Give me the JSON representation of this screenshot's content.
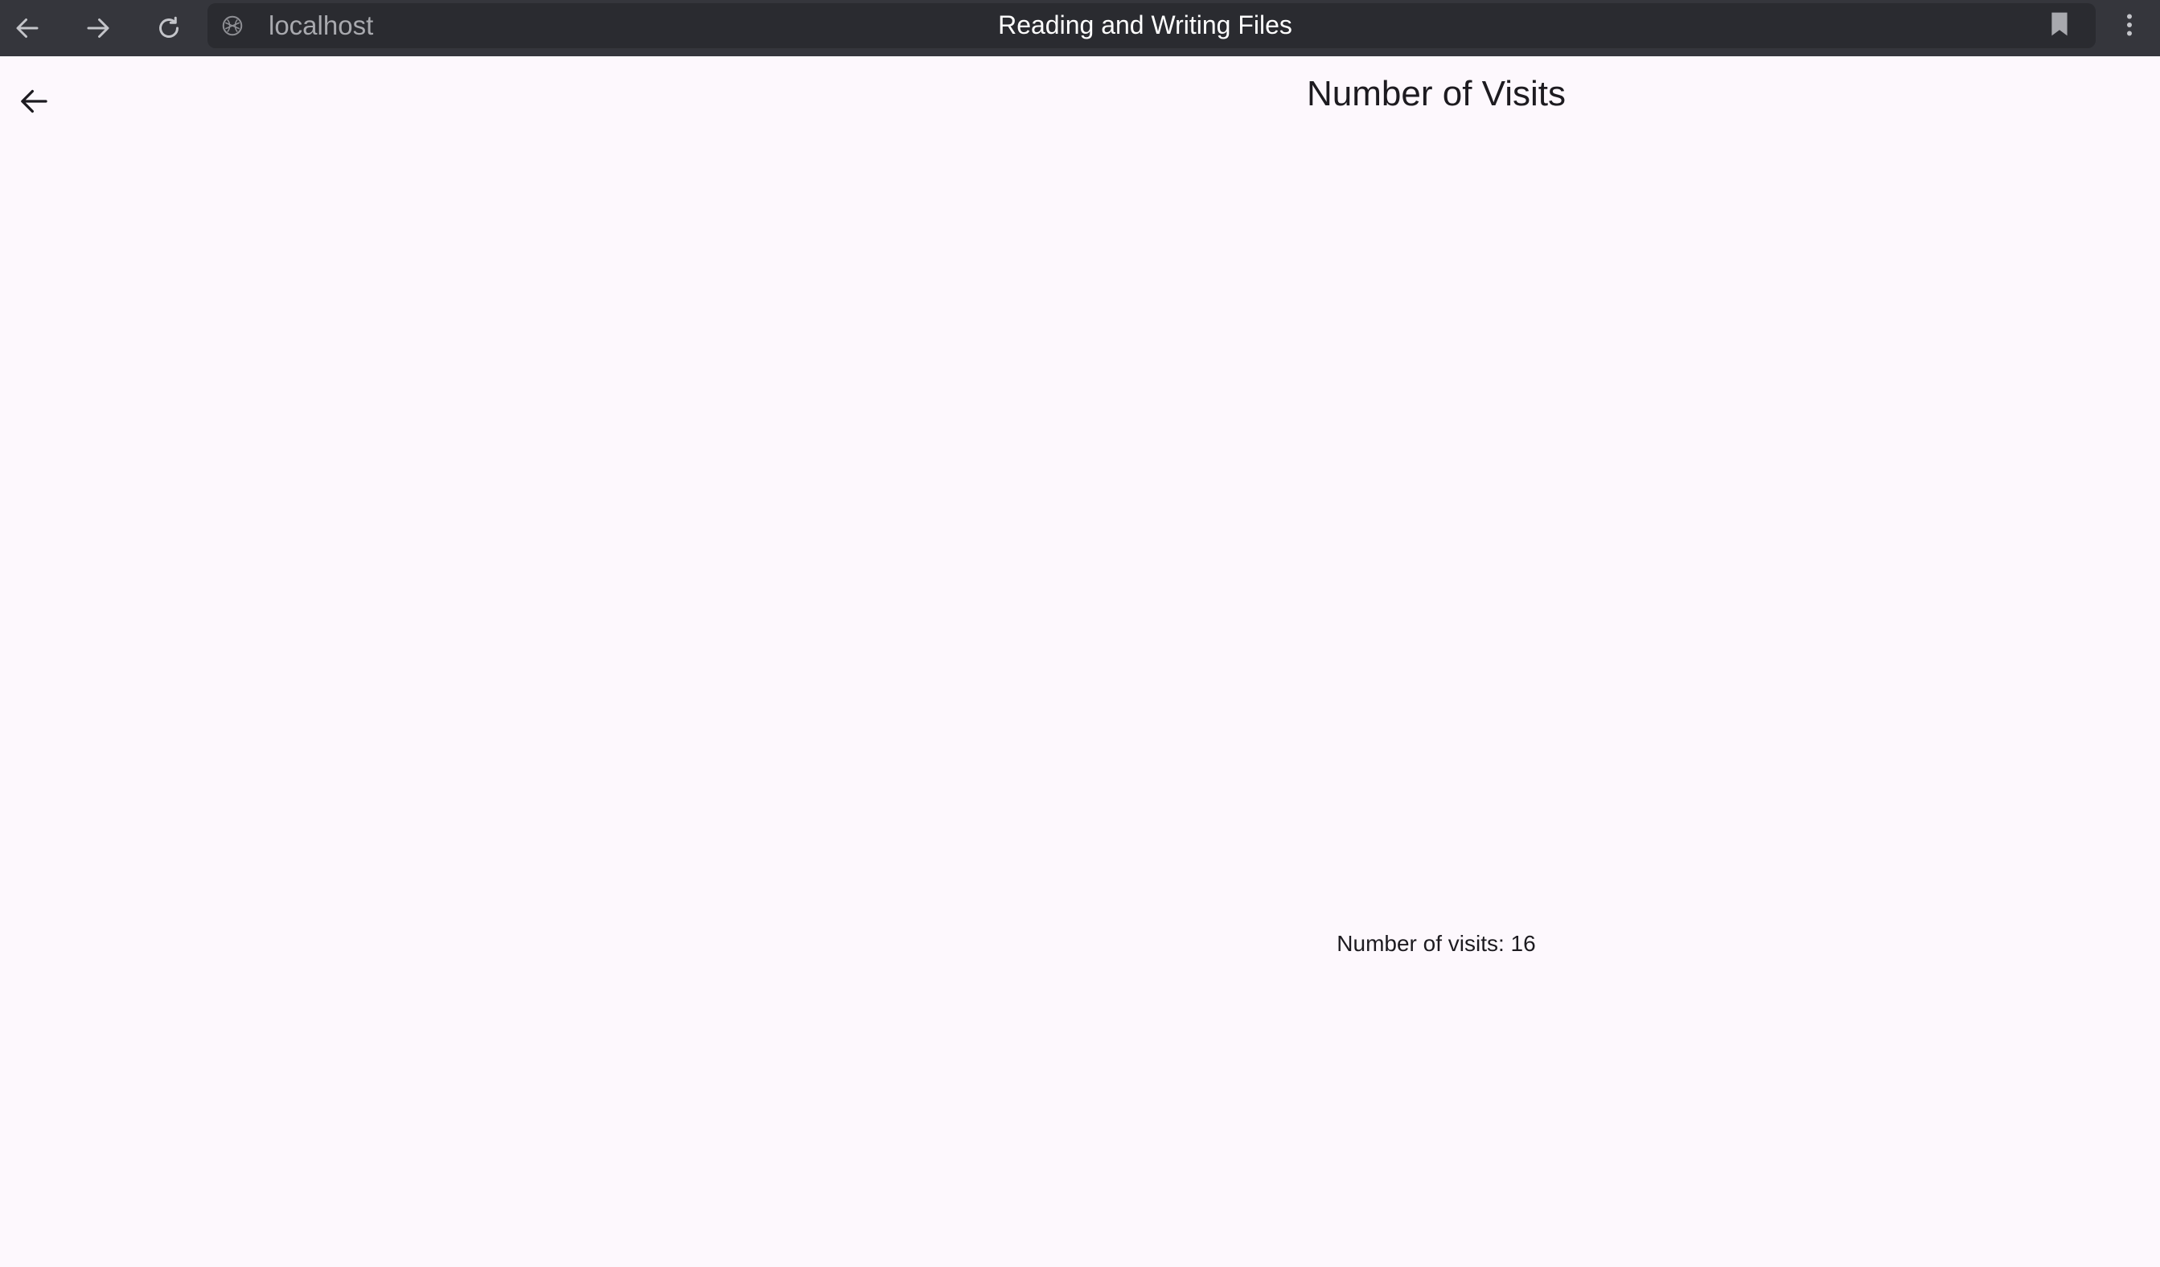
{
  "browser": {
    "url": "localhost",
    "tab_title": "Reading and Writing Files",
    "icons": {
      "back": "arrow-left-icon",
      "forward": "arrow-right-icon",
      "reload": "reload-icon",
      "site": "globe-icon",
      "bookmark": "bookmark-icon",
      "menu": "more-vert-icon"
    },
    "colors": {
      "bar_bg": "#35363c",
      "pill_bg": "#2a2b30",
      "title_text": "#ffffff",
      "url_text": "#a8a9ae"
    }
  },
  "app": {
    "title": "Number of Visits",
    "visits_text": "Number of visits: 16",
    "back_icon": "arrow-left-icon",
    "colors": {
      "background": "#fdf8fd",
      "text": "#1d1b20"
    }
  }
}
